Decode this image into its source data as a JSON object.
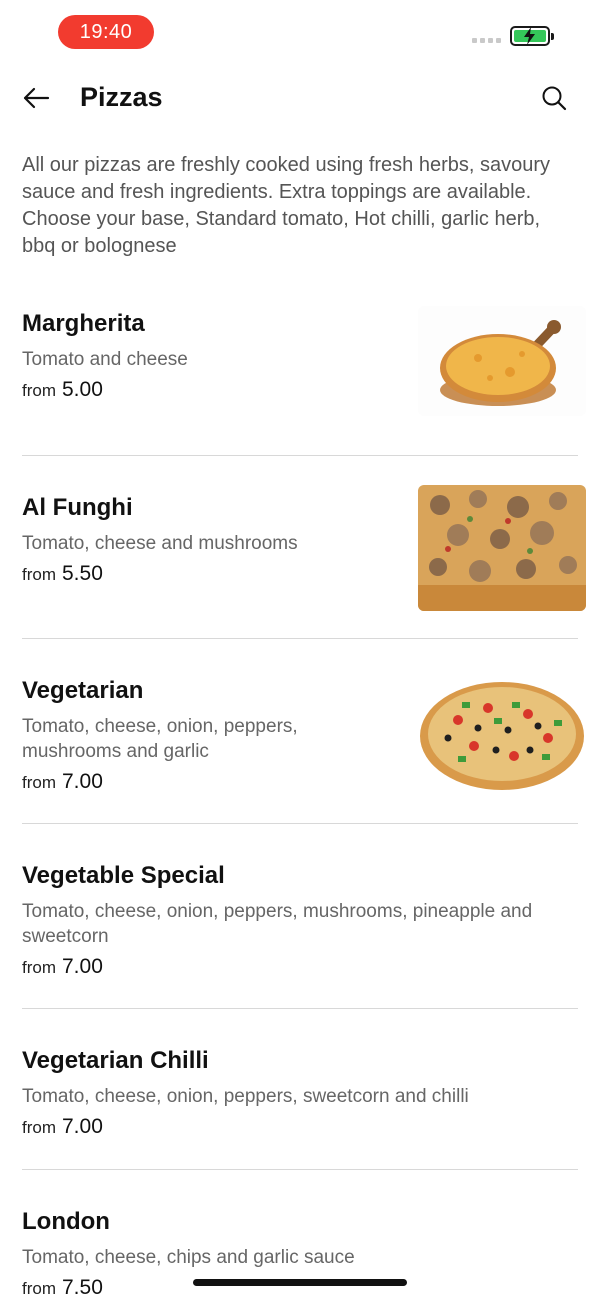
{
  "status_bar": {
    "time": "19:40",
    "battery_color": "#34c759",
    "time_pill_color": "#f23b2f"
  },
  "header": {
    "title": "Pizzas",
    "back_icon": "arrow-left-icon",
    "search_icon": "search-icon"
  },
  "intro": "All our pizzas are freshly cooked using fresh herbs, savoury sauce and fresh ingredients. Extra toppings are available. Choose your base, Standard tomato, Hot chilli, garlic herb, bbq or bolognese",
  "items": [
    {
      "name": "Margherita",
      "description": "Tomato and cheese",
      "from_label": "from",
      "price": "5.00"
    },
    {
      "name": "Al Funghi",
      "description": "Tomato, cheese and mushrooms",
      "from_label": "from",
      "price": "5.50"
    },
    {
      "name": "Vegetarian",
      "description": "Tomato, cheese, onion, peppers, mushrooms and garlic",
      "from_label": "from",
      "price": "7.00"
    },
    {
      "name": "Vegetable Special",
      "description": "Tomato, cheese, onion, peppers, mushrooms, pineapple and sweetcorn",
      "from_label": "from",
      "price": "7.00"
    },
    {
      "name": "Vegetarian Chilli",
      "description": "Tomato, cheese, onion, peppers, sweetcorn and chilli",
      "from_label": "from",
      "price": "7.00"
    },
    {
      "name": "London",
      "description": "Tomato, cheese, chips and garlic sauce",
      "from_label": "from",
      "price": "7.50"
    }
  ]
}
